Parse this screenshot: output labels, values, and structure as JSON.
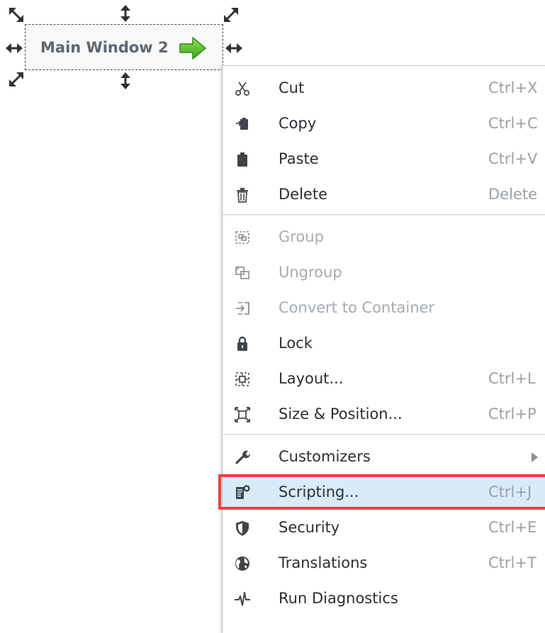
{
  "component": {
    "label": "Main Window 2",
    "arrow_icon": "green-right-arrow-icon",
    "arrow_color": "#5bbf2a",
    "handles": [
      "resize-nw-icon",
      "resize-n-icon",
      "resize-ne-icon",
      "resize-w-icon",
      "resize-e-icon",
      "resize-sw-icon",
      "resize-s-icon"
    ]
  },
  "menu": {
    "items": [
      {
        "label": "Cut",
        "shortcut": "Ctrl+X",
        "icon": "scissors-icon",
        "enabled": true
      },
      {
        "label": "Copy",
        "shortcut": "Ctrl+C",
        "icon": "copy-icon",
        "enabled": true
      },
      {
        "label": "Paste",
        "shortcut": "Ctrl+V",
        "icon": "clipboard-icon",
        "enabled": true
      },
      {
        "label": "Delete",
        "shortcut": "Delete",
        "icon": "trash-icon",
        "enabled": true
      },
      {
        "label": "Group",
        "shortcut": "",
        "icon": "group-icon",
        "enabled": false
      },
      {
        "label": "Ungroup",
        "shortcut": "",
        "icon": "ungroup-icon",
        "enabled": false
      },
      {
        "label": "Convert to Container",
        "shortcut": "",
        "icon": "convert-container-icon",
        "enabled": false
      },
      {
        "label": "Lock",
        "shortcut": "",
        "icon": "lock-icon",
        "enabled": true
      },
      {
        "label": "Layout...",
        "shortcut": "Ctrl+L",
        "icon": "layout-icon",
        "enabled": true
      },
      {
        "label": "Size & Position...",
        "shortcut": "Ctrl+P",
        "icon": "size-position-icon",
        "enabled": true
      },
      {
        "label": "Customizers",
        "shortcut": "",
        "icon": "wrench-icon",
        "enabled": true,
        "submenu": true
      },
      {
        "label": "Scripting...",
        "shortcut": "Ctrl+J",
        "icon": "scripting-icon",
        "enabled": true,
        "highlighted": true
      },
      {
        "label": "Security",
        "shortcut": "Ctrl+E",
        "icon": "shield-icon",
        "enabled": true
      },
      {
        "label": "Translations",
        "shortcut": "Ctrl+T",
        "icon": "globe-icon",
        "enabled": true
      },
      {
        "label": "Run Diagnostics",
        "shortcut": "",
        "icon": "pulse-icon",
        "enabled": true
      }
    ],
    "highlight_color": "#d9ebfb",
    "callout_border_color": "#ef3f45"
  }
}
